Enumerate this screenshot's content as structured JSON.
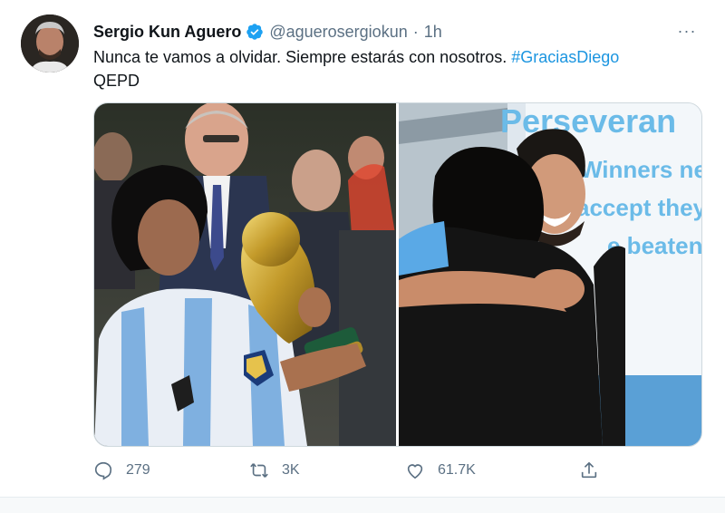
{
  "tweet": {
    "author": {
      "name": "Sergio Kun Aguero",
      "handle": "@aguerosergiokun",
      "time": "1h",
      "verified": true
    },
    "text": "Nunca te vamos a olvidar. Siempre estarás con nosotros.",
    "hashtag": "#GraciasDiego",
    "text_line2": "QEPD",
    "media": {
      "left": {
        "description_icon": "photo"
      },
      "right": {
        "banner_lines": [
          "Perseveran",
          "Winners ne",
          "accept they",
          "e beaten."
        ]
      }
    },
    "actions": {
      "reply_count": "279",
      "retweet_count": "3K",
      "like_count": "61.7K"
    },
    "more_label": "···"
  },
  "colors": {
    "link": "#1b95e0",
    "muted": "#5b7083",
    "verified": "#1da1f2"
  }
}
